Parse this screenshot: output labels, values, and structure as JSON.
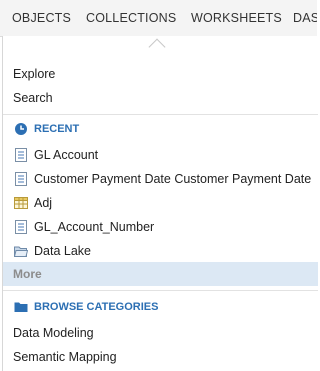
{
  "tabs": [
    {
      "label": "OBJECTS"
    },
    {
      "label": "COLLECTIONS"
    },
    {
      "label": "WORKSHEETS"
    },
    {
      "label": "DAS"
    }
  ],
  "menu": {
    "actions": [
      {
        "label": "Explore"
      },
      {
        "label": "Search"
      }
    ],
    "recent": {
      "title": "RECENT",
      "icon": "clock-icon",
      "items": [
        {
          "label": "GL Account",
          "icon": "document-icon"
        },
        {
          "label": "Customer Payment Date Customer Payment Date",
          "icon": "document-icon"
        },
        {
          "label": "Adj",
          "icon": "table-icon"
        },
        {
          "label": "GL_Account_Number",
          "icon": "document-icon"
        },
        {
          "label": "Data Lake",
          "icon": "folder-open-icon"
        }
      ],
      "more_label": "More"
    },
    "browse": {
      "title": "BROWSE CATEGORIES",
      "icon": "folder-icon",
      "items": [
        {
          "label": "Data Modeling"
        },
        {
          "label": "Semantic Mapping"
        }
      ]
    }
  },
  "colors": {
    "accent": "#2c6fb3",
    "highlight": "#dce8f4",
    "more_text": "#8c8c8c"
  }
}
